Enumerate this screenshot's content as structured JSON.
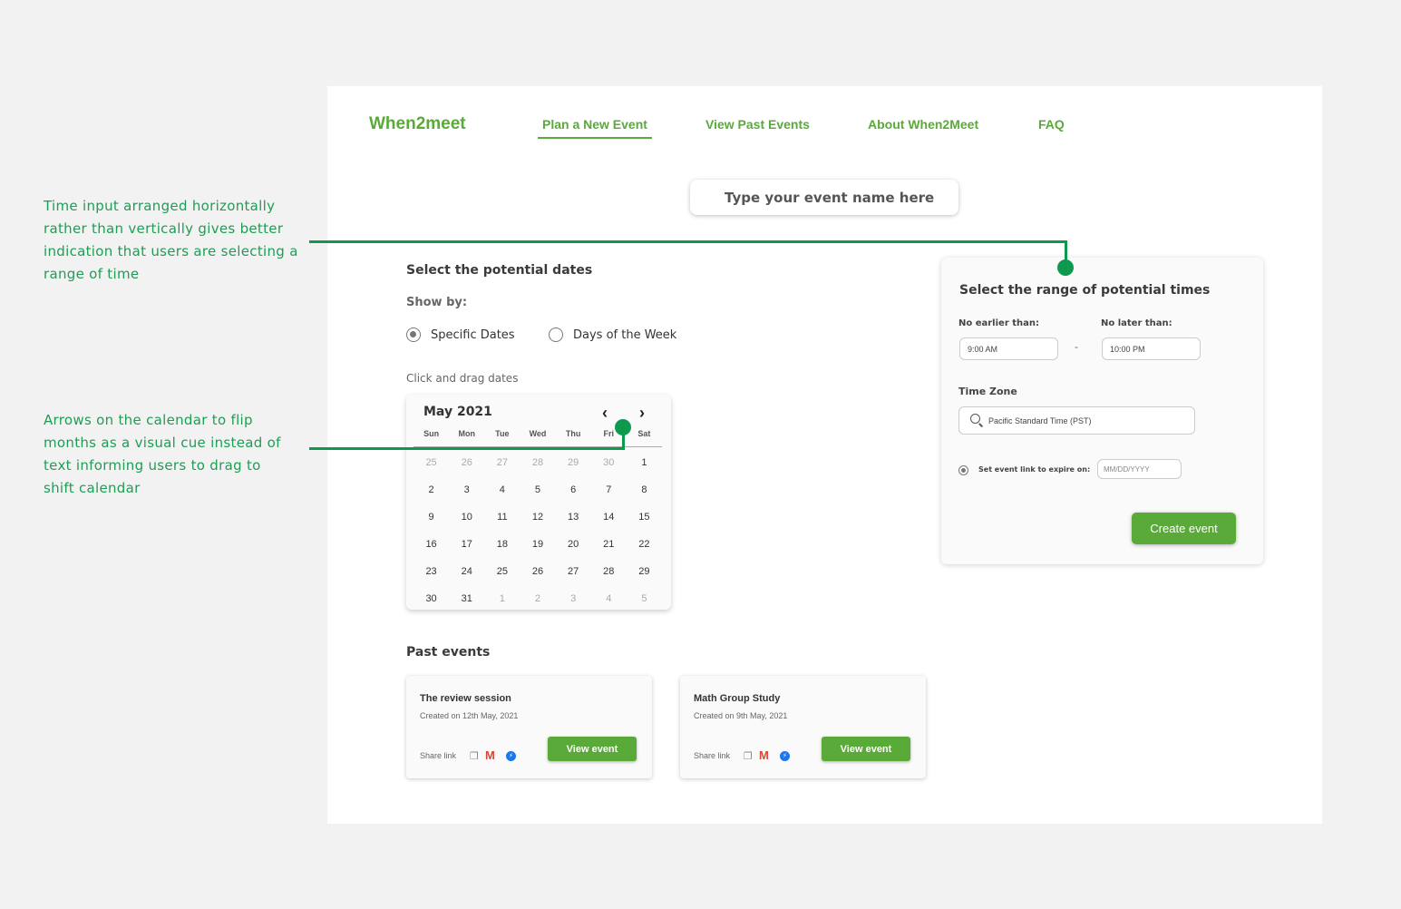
{
  "annotations": {
    "time_input": "Time input arranged horizontally rather than vertically gives better indication that users are selecting a range of time",
    "calendar_arrows": "Arrows on the calendar to flip months as a visual cue instead of text informing users to drag to shift calendar"
  },
  "header": {
    "logo": "When2meet",
    "nav": [
      "Plan a New Event",
      "View Past Events",
      "About When2Meet",
      "FAQ"
    ],
    "active_nav": "Plan a New Event"
  },
  "event_name": {
    "placeholder": "Type your event name here"
  },
  "dates": {
    "title": "Select the potential dates",
    "show_by": "Show by:",
    "options": [
      "Specific Dates",
      "Days of the Week"
    ],
    "selected": "Specific Dates",
    "hint": "Click and drag dates"
  },
  "calendar": {
    "month": "May 2021",
    "weekdays": [
      "Sun",
      "Mon",
      "Tue",
      "Wed",
      "Thu",
      "Fri",
      "Sat"
    ],
    "days": [
      {
        "d": "25",
        "m": true
      },
      {
        "d": "26",
        "m": true
      },
      {
        "d": "27",
        "m": true
      },
      {
        "d": "28",
        "m": true
      },
      {
        "d": "29",
        "m": true
      },
      {
        "d": "30",
        "m": true
      },
      {
        "d": "1",
        "m": false
      },
      {
        "d": "2",
        "m": false
      },
      {
        "d": "3",
        "m": false
      },
      {
        "d": "4",
        "m": false
      },
      {
        "d": "5",
        "m": false
      },
      {
        "d": "6",
        "m": false
      },
      {
        "d": "7",
        "m": false
      },
      {
        "d": "8",
        "m": false
      },
      {
        "d": "9",
        "m": false
      },
      {
        "d": "10",
        "m": false
      },
      {
        "d": "11",
        "m": false
      },
      {
        "d": "12",
        "m": false
      },
      {
        "d": "13",
        "m": false
      },
      {
        "d": "14",
        "m": false
      },
      {
        "d": "15",
        "m": false
      },
      {
        "d": "16",
        "m": false
      },
      {
        "d": "17",
        "m": false
      },
      {
        "d": "18",
        "m": false
      },
      {
        "d": "19",
        "m": false
      },
      {
        "d": "20",
        "m": false
      },
      {
        "d": "21",
        "m": false
      },
      {
        "d": "22",
        "m": false
      },
      {
        "d": "23",
        "m": false
      },
      {
        "d": "24",
        "m": false
      },
      {
        "d": "25",
        "m": false
      },
      {
        "d": "26",
        "m": false
      },
      {
        "d": "27",
        "m": false
      },
      {
        "d": "28",
        "m": false
      },
      {
        "d": "29",
        "m": false
      },
      {
        "d": "30",
        "m": false
      },
      {
        "d": "31",
        "m": false
      },
      {
        "d": "1",
        "m": true
      },
      {
        "d": "2",
        "m": true
      },
      {
        "d": "3",
        "m": true
      },
      {
        "d": "4",
        "m": true
      },
      {
        "d": "5",
        "m": true
      }
    ]
  },
  "past_events": {
    "title": "Past events",
    "items": [
      {
        "name": "The review session",
        "created": "Created on 12th May, 2021",
        "share": "Share link",
        "button": "View event"
      },
      {
        "name": "Math Group Study",
        "created": "Created on 9th May, 2021",
        "share": "Share link",
        "button": "View event"
      }
    ]
  },
  "times": {
    "title": "Select the range of potential times",
    "earliest_label": "No earlier than:",
    "earliest_value": "9:00 AM",
    "latest_label": "No later than:",
    "latest_value": "10:00 PM",
    "separator": "-",
    "timezone_label": "Time Zone",
    "timezone_value": "Pacific Standard Time (PST)",
    "expire_label": "Set event link to expire on:",
    "expire_placeholder": "MM/DD/YYYY",
    "create_button": "Create event"
  },
  "colors": {
    "brand": "#5aaa3a",
    "callout": "#0e9a4e"
  }
}
